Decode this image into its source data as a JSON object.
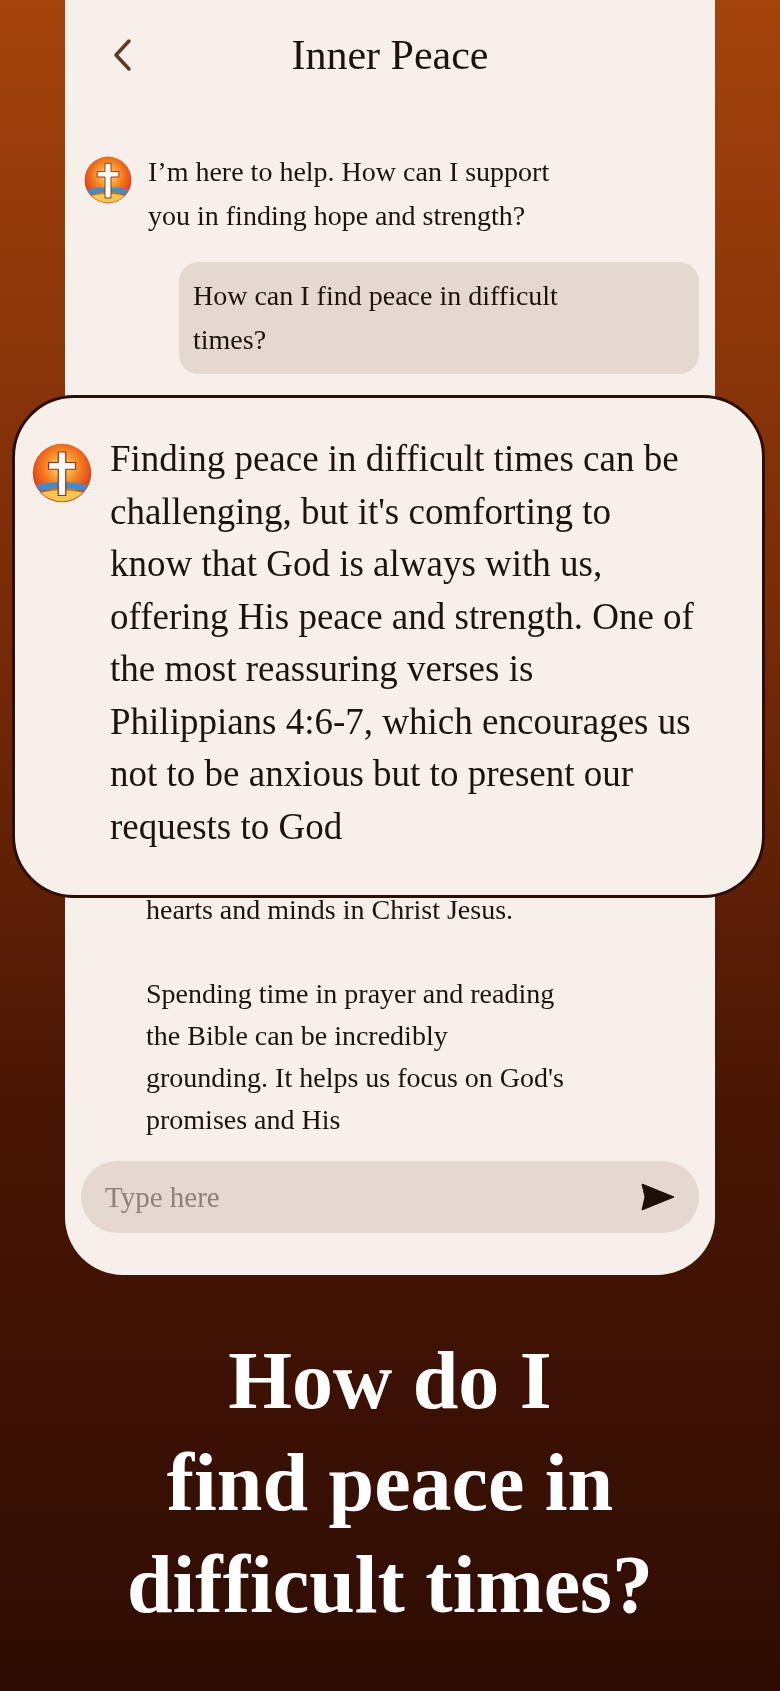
{
  "header": {
    "title": "Inner Peace"
  },
  "messages": [
    {
      "kind": "bot",
      "text": "I’m here to help. How can I support you in finding hope and strength?"
    },
    {
      "kind": "user",
      "text": "How can I find peace in difficult times?"
    }
  ],
  "callout": {
    "text": "Finding peace in difficult times can be challenging, but it's comforting to know that God is always with us, offering His peace and strength. One of the most reassuring verses is Philippians 4:6-7, which encourages us not to be anxious but to present our requests to God"
  },
  "continued_message": {
    "paragraphs": [
      "hearts and minds in Christ Jesus.",
      "Spending time in prayer and reading the Bible can be incredibly grounding. It helps us focus on God's promises and His"
    ]
  },
  "composer": {
    "placeholder": "Type here"
  },
  "headline": "How do I\nfind peace in\ndifficult times?"
}
